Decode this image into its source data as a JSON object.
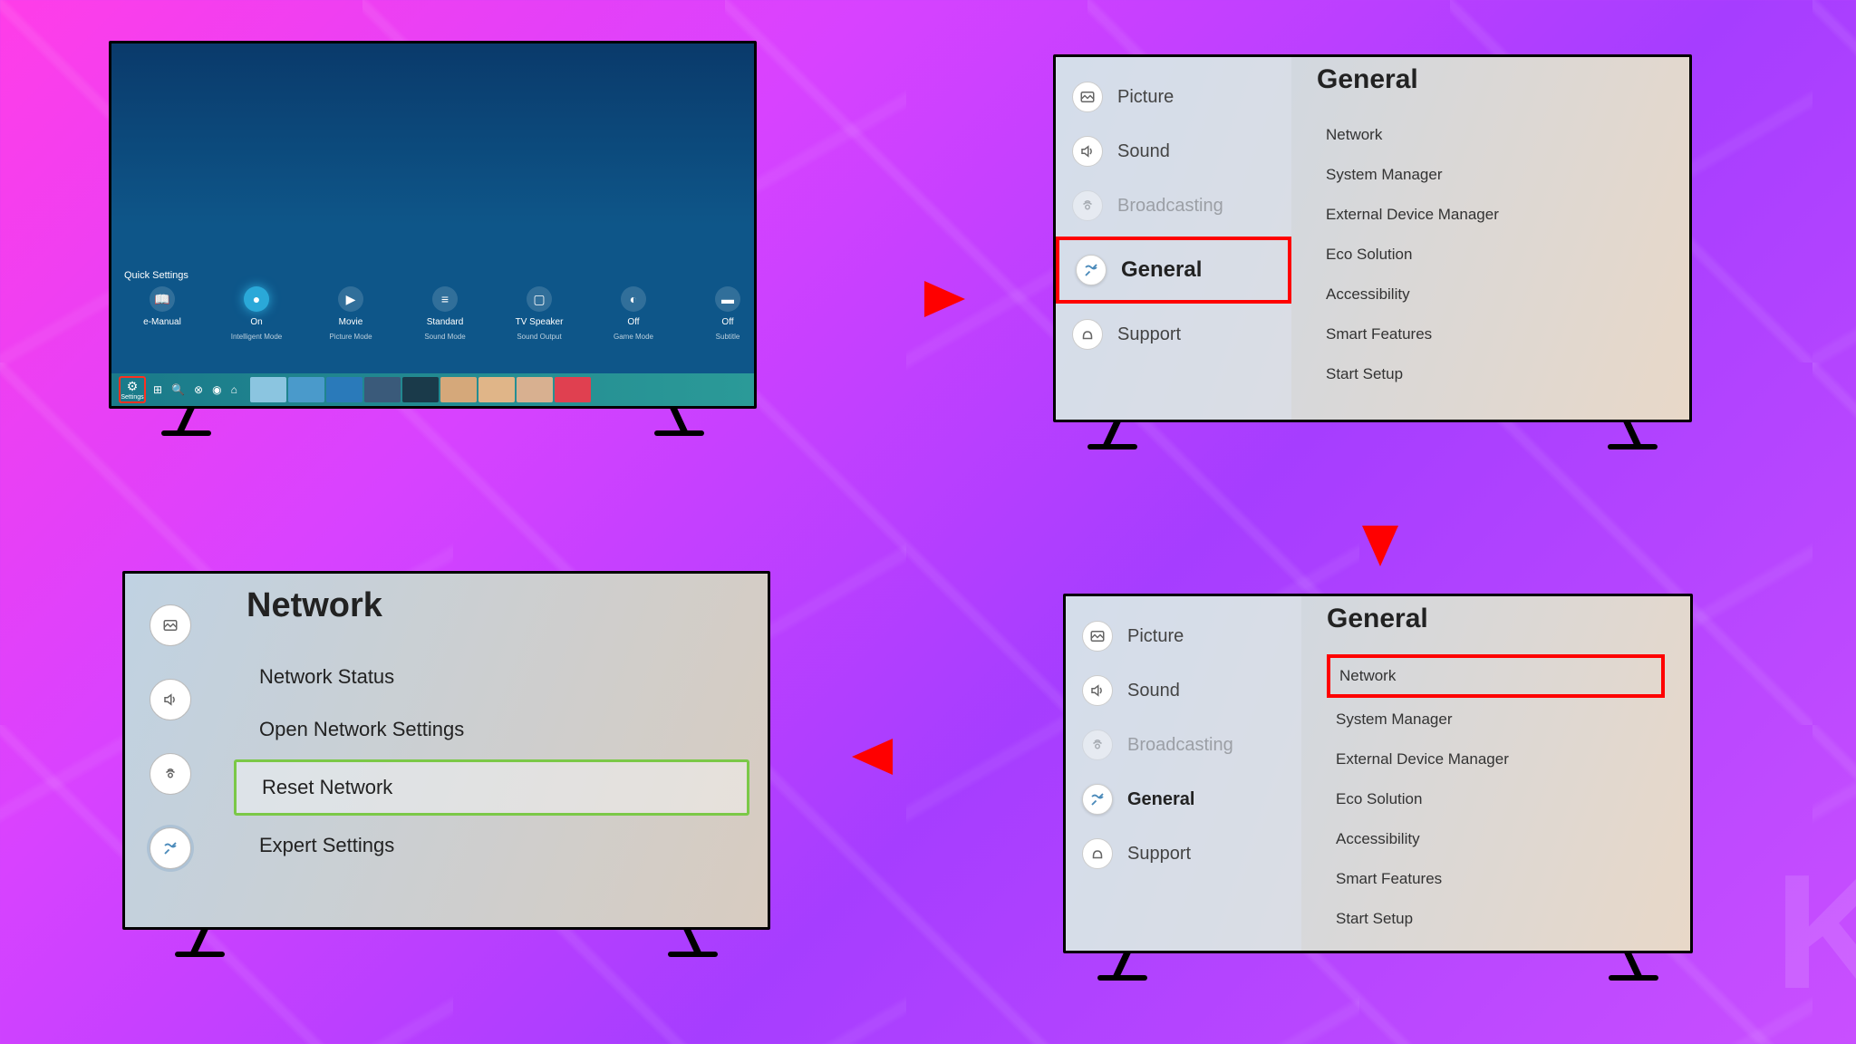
{
  "screen1": {
    "quick_label": "Quick Settings",
    "items": [
      {
        "label": "e-Manual",
        "sub": "",
        "icon": "📖"
      },
      {
        "label": "On",
        "sub": "Intelligent Mode",
        "icon": "●",
        "active": true
      },
      {
        "label": "Movie",
        "sub": "Picture Mode",
        "icon": "▶"
      },
      {
        "label": "Standard",
        "sub": "Sound Mode",
        "icon": "≡"
      },
      {
        "label": "TV Speaker",
        "sub": "Sound Output",
        "icon": "▢"
      },
      {
        "label": "Off",
        "sub": "Game Mode",
        "icon": "◐"
      },
      {
        "label": "Off",
        "sub": "Subtitle",
        "icon": "▬"
      }
    ],
    "settings_label": "Settings",
    "tiles": [
      "#8bc5e0",
      "#4a9acb",
      "#2a7aba",
      "#3a5a7a",
      "#1a3a4a",
      "#d5a87a",
      "#e0b588",
      "#d8b090",
      "#e04050"
    ]
  },
  "screen2": {
    "title": "General",
    "categories": [
      {
        "label": "Picture",
        "icon": "pic"
      },
      {
        "label": "Sound",
        "icon": "snd"
      },
      {
        "label": "Broadcasting",
        "icon": "brd",
        "disabled": true
      },
      {
        "label": "General",
        "icon": "gen",
        "highlighted": true
      },
      {
        "label": "Support",
        "icon": "sup"
      }
    ],
    "options": [
      {
        "label": "Network"
      },
      {
        "label": "System Manager"
      },
      {
        "label": "External Device Manager"
      },
      {
        "label": "Eco Solution"
      },
      {
        "label": "Accessibility"
      },
      {
        "label": "Smart Features"
      },
      {
        "label": "Start Setup"
      }
    ]
  },
  "screen3": {
    "title": "General",
    "categories": [
      {
        "label": "Picture",
        "icon": "pic"
      },
      {
        "label": "Sound",
        "icon": "snd"
      },
      {
        "label": "Broadcasting",
        "icon": "brd",
        "disabled": true
      },
      {
        "label": "General",
        "icon": "gen",
        "selected": true
      },
      {
        "label": "Support",
        "icon": "sup"
      }
    ],
    "options": [
      {
        "label": "Network",
        "highlighted": true
      },
      {
        "label": "System Manager"
      },
      {
        "label": "External Device Manager"
      },
      {
        "label": "Eco Solution"
      },
      {
        "label": "Accessibility"
      },
      {
        "label": "Smart Features"
      },
      {
        "label": "Start Setup"
      }
    ]
  },
  "screen4": {
    "title": "Network",
    "icons": [
      "pic",
      "snd",
      "brd",
      "gen"
    ],
    "active_icon": 3,
    "options": [
      {
        "label": "Network Status"
      },
      {
        "label": "Open Network Settings"
      },
      {
        "label": "Reset Network",
        "highlighted": true
      },
      {
        "label": "Expert Settings"
      }
    ]
  }
}
